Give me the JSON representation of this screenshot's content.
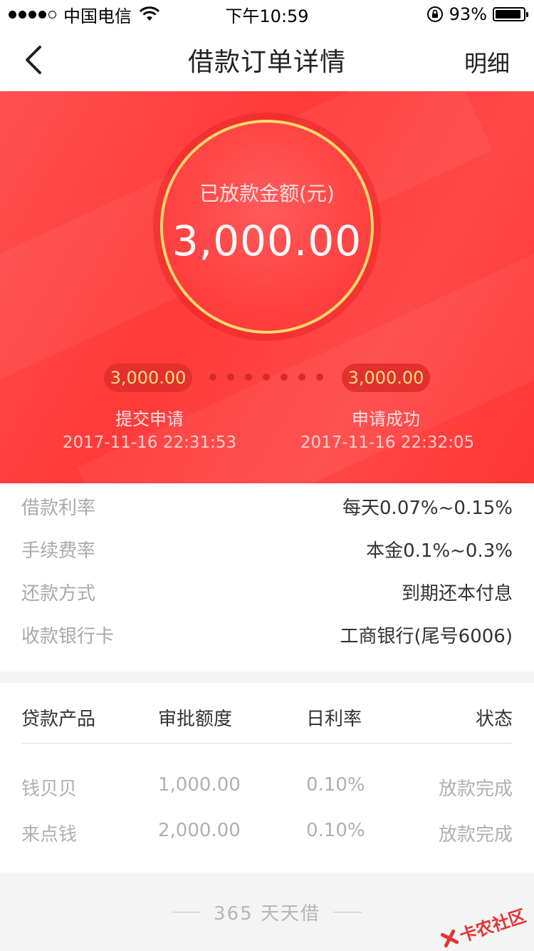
{
  "status_bar": {
    "carrier": "中国电信",
    "time": "下午10:59",
    "battery": "93%",
    "battery_level": 0.93
  },
  "nav": {
    "title": "借款订单详情",
    "right_label": "明细"
  },
  "hero": {
    "amount_label": "已放款金额(元)",
    "amount": "3,000.00",
    "steps": [
      {
        "amount": "3,000.00",
        "label": "提交申请",
        "time": "2017-11-16 22:31:53"
      },
      {
        "amount": "3,000.00",
        "label": "申请成功",
        "time": "2017-11-16 22:32:05"
      }
    ]
  },
  "info": [
    {
      "label": "借款利率",
      "value": "每天0.07%~0.15%"
    },
    {
      "label": "手续费率",
      "value": "本金0.1%~0.3%"
    },
    {
      "label": "还款方式",
      "value": "到期还本付息"
    },
    {
      "label": "收款银行卡",
      "value": "工商银行(尾号6006)"
    }
  ],
  "table": {
    "headers": [
      "贷款产品",
      "审批额度",
      "日利率",
      "状态"
    ],
    "rows": [
      [
        "钱贝贝",
        "1,000.00",
        "0.10%",
        "放款完成"
      ],
      [
        "来点钱",
        "2,000.00",
        "0.10%",
        "放款完成"
      ]
    ]
  },
  "footer": {
    "text": "365 天天借"
  },
  "watermark": {
    "text": "卡农社区"
  },
  "colors": {
    "accent": "#ff4040",
    "ring": "#ffd86a",
    "pill_text": "#ffdf7d"
  }
}
